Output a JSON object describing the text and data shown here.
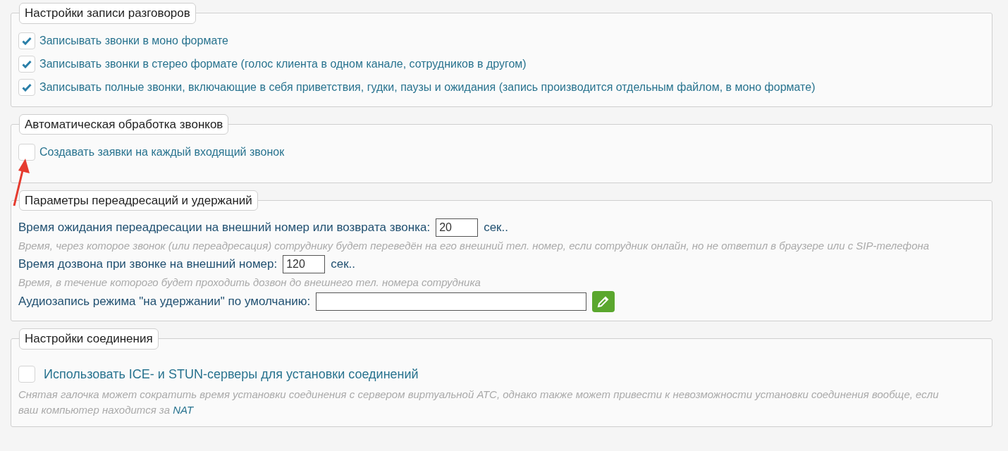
{
  "sections": [
    {
      "title": "Настройки записи разговоров",
      "items": [
        {
          "kind": "checkbox",
          "label": "Записывать звонки в моно формате",
          "checked": true
        },
        {
          "kind": "checkbox",
          "label": "Записывать звонки в стерео формате (голос клиента в одном канале, сотрудников в другом)",
          "checked": true
        },
        {
          "kind": "checkbox",
          "label": "Записывать полные звонки, включающие в себя приветствия, гудки, паузы и ожидания (запись производится отдельным файлом, в моно формате)",
          "checked": true
        }
      ]
    },
    {
      "title": "Автоматическая обработка звонков",
      "items": [
        {
          "kind": "checkbox",
          "label": "Создавать заявки на каждый входящий звонок",
          "checked": false
        }
      ]
    },
    {
      "title": "Параметры переадресаций и удержаний",
      "items": [
        {
          "kind": "number",
          "label": "Время ожидания переадресации на внешний номер или возврата звонка:",
          "value": "20",
          "unit": "сек..",
          "hint": "Время, через которое звонок (или переадресация) сотруднику будет переведён на его внешний тел. номер, если сотрудник онлайн, но не ответил в браузере или с SIP-телефона"
        },
        {
          "kind": "number",
          "label": "Время дозвона при звонке на внешний номер:",
          "value": "120",
          "unit": "сек..",
          "hint": "Время, в течение которого будет проходить дозвон до внешнего тел. номера сотрудника"
        },
        {
          "kind": "file",
          "label": "Аудиозапись режима \"на удержании\" по умолчанию:"
        }
      ]
    },
    {
      "title": "Настройки соединения",
      "items": [
        {
          "kind": "option",
          "label": "Использовать ICE- и STUN-серверы для установки соединений",
          "checked": false,
          "hint": "Снятая галочка может сократить время установки соединения с сервером виртуальной АТС, однако также может привести к невозможности установки соединения вообще, если ваш компьютер находится за",
          "hint_link": "NAT"
        }
      ]
    }
  ]
}
